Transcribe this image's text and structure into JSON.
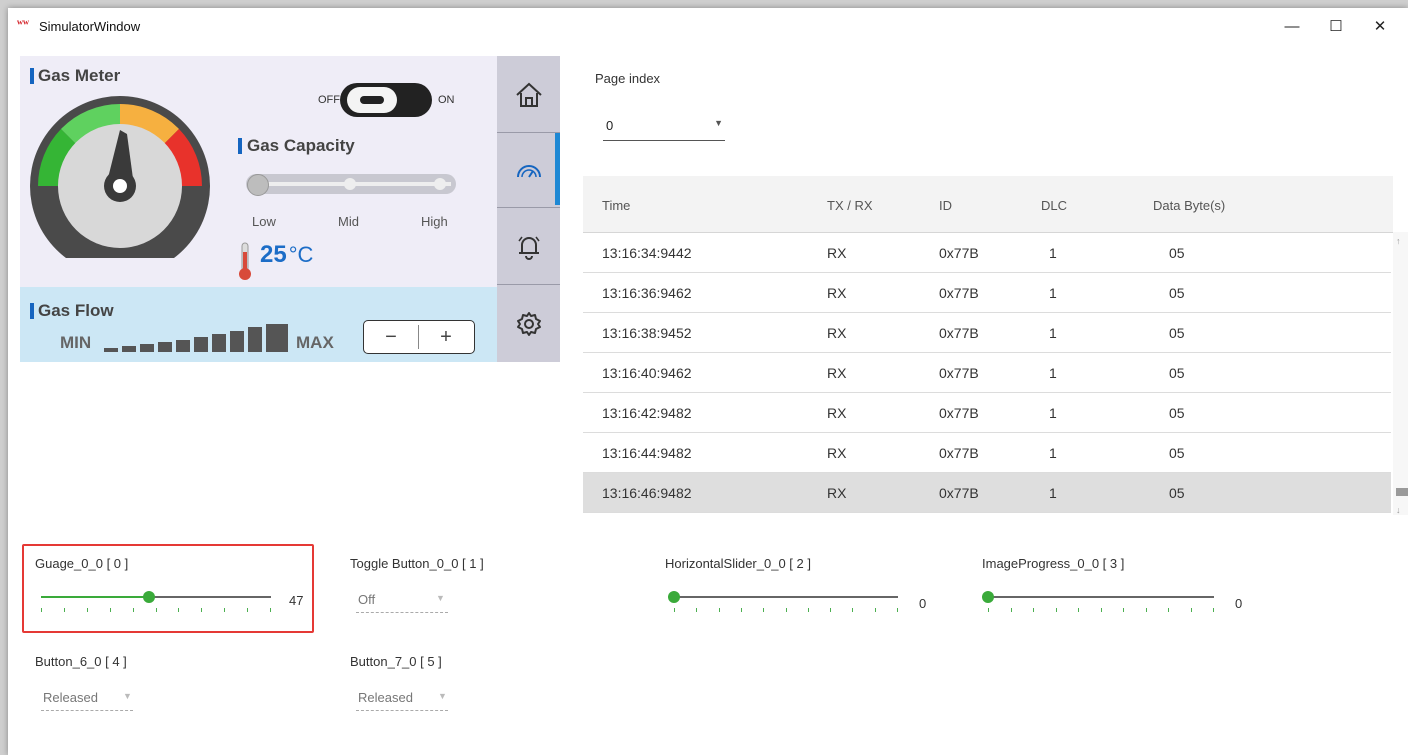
{
  "window": {
    "title": "SimulatorWindow",
    "logo_text": "ᵂᵂ",
    "controls": {
      "minimize": "—",
      "maximize": "☐",
      "close": "✕"
    }
  },
  "hmi": {
    "gas_meter_title": "Gas Meter",
    "toggle": {
      "off_label": "OFF",
      "on_label": "ON",
      "state": "on"
    },
    "gas_capacity_title": "Gas Capacity",
    "capacity_labels": {
      "low": "Low",
      "mid": "Mid",
      "high": "High"
    },
    "temperature": {
      "value": "25",
      "unit": "°C"
    },
    "gas_flow_title": "Gas Flow",
    "flow_min": "MIN",
    "flow_max": "MAX",
    "stepper": {
      "minus": "−",
      "plus": "+"
    },
    "sidebar": [
      "home-icon",
      "gauge-icon",
      "bell-icon",
      "gear-icon"
    ],
    "colors": {
      "accent": "#1565c0",
      "gauge_green": "#3bbf3b",
      "gauge_orange": "#f6a93a",
      "gauge_red": "#e8322b"
    }
  },
  "page_index": {
    "label": "Page index",
    "value": "0"
  },
  "messages": {
    "columns": [
      "Time",
      "TX / RX",
      "ID",
      "DLC",
      "Data Byte(s)"
    ],
    "rows": [
      [
        "13:16:34:9442",
        "RX",
        "0x77B",
        "1",
        "05"
      ],
      [
        "13:16:36:9462",
        "RX",
        "0x77B",
        "1",
        "05"
      ],
      [
        "13:16:38:9452",
        "RX",
        "0x77B",
        "1",
        "05"
      ],
      [
        "13:16:40:9462",
        "RX",
        "0x77B",
        "1",
        "05"
      ],
      [
        "13:16:42:9482",
        "RX",
        "0x77B",
        "1",
        "05"
      ],
      [
        "13:16:44:9482",
        "RX",
        "0x77B",
        "1",
        "05"
      ],
      [
        "13:16:46:9482",
        "RX",
        "0x77B",
        "1",
        "05"
      ]
    ],
    "selected_row": 6
  },
  "controls": {
    "gauge": {
      "label": "Guage_0_0  [ 0 ]",
      "value": "47",
      "fraction": 0.47
    },
    "toggle_button": {
      "label": "Toggle Button_0_0  [ 1 ]",
      "value": "Off"
    },
    "hslider": {
      "label": "HorizontalSlider_0_0  [ 2 ]",
      "value": "0",
      "fraction": 0
    },
    "image_progress": {
      "label": "ImageProgress_0_0  [ 3 ]",
      "value": "0",
      "fraction": 0
    },
    "button6": {
      "label": "Button_6_0  [ 4 ]",
      "value": "Released"
    },
    "button7": {
      "label": "Button_7_0  [ 5 ]",
      "value": "Released"
    }
  }
}
